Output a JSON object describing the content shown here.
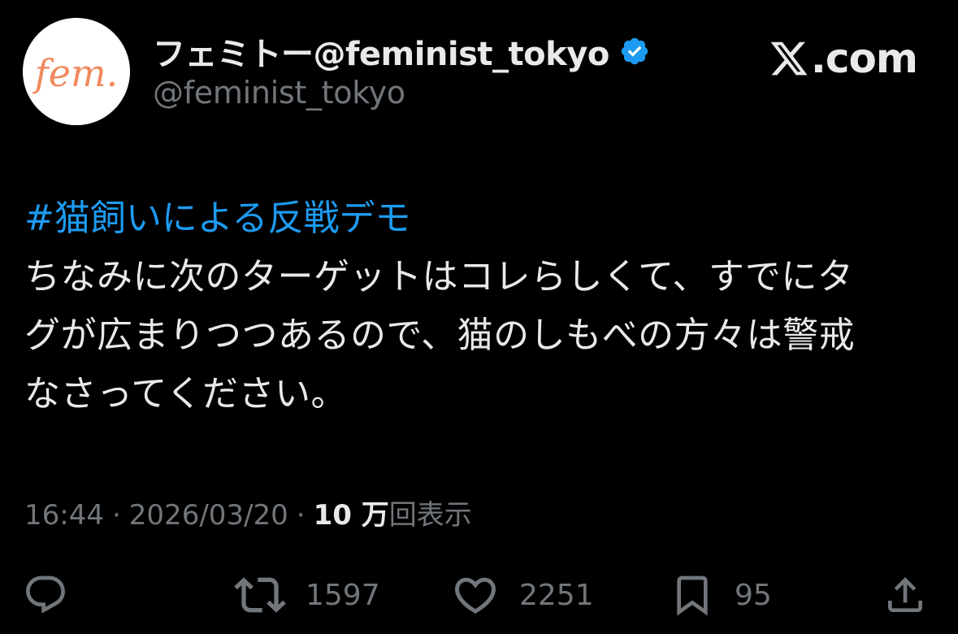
{
  "author": {
    "display_name": "フェミトー@feminist_tokyo",
    "handle": "@feminist_tokyo",
    "avatar_text": "fem.",
    "verified": true
  },
  "brand": {
    "text": ".com",
    "icon": "x-logo-icon"
  },
  "tweet": {
    "hashtag": "#猫飼いによる反戦デモ",
    "lines": [
      "ちなみに次のターゲットはコレらしくて、すでにタ",
      "グが広まりつつあるので、猫のしもべの方々は警戒",
      "なさってください。"
    ]
  },
  "meta": {
    "time": "16:44",
    "separator": "·",
    "date": "2026/03/20",
    "views_count": "10 万",
    "views_label": "回表示"
  },
  "actions": {
    "reply_icon": "reply-icon",
    "retweets": "1597",
    "likes": "2251",
    "bookmarks": "95",
    "share_icon": "share-icon"
  },
  "colors": {
    "background": "#000000",
    "text": "#e7e9ea",
    "secondary": "#71767b",
    "link": "#1d9bf0",
    "verified": "#1d9bf0",
    "avatar_text": "#f08a5d"
  }
}
